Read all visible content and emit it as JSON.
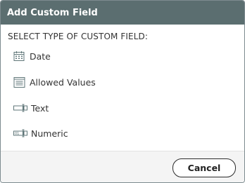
{
  "dialog": {
    "title": "Add Custom Field",
    "prompt": "SELECT TYPE OF CUSTOM FIELD:",
    "options": [
      {
        "label": "Date",
        "icon": "calendar-icon"
      },
      {
        "label": "Allowed Values",
        "icon": "list-icon"
      },
      {
        "label": "Text",
        "icon": "text-field-icon"
      },
      {
        "label": "Numeric",
        "icon": "numeric-field-icon"
      }
    ],
    "cancel_label": "Cancel"
  },
  "colors": {
    "titlebar": "#5b6e70",
    "icon": "#5f7678"
  }
}
